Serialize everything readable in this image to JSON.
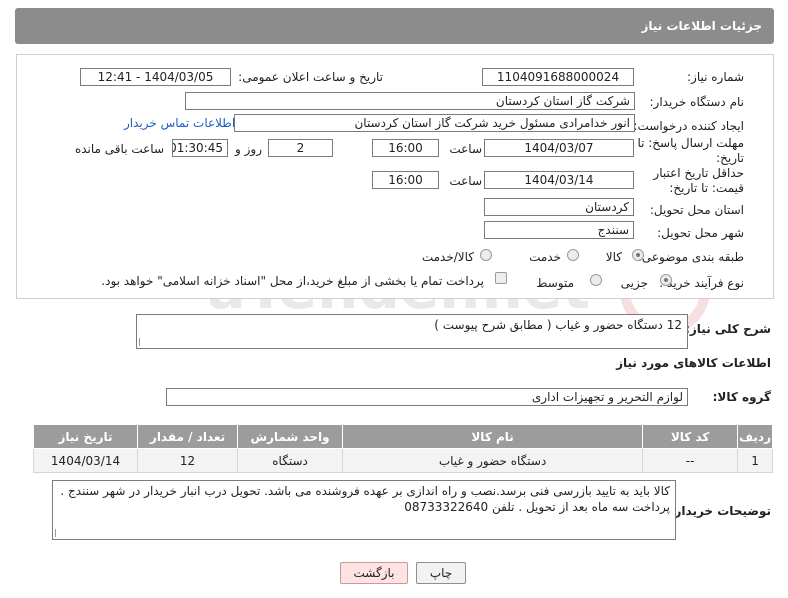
{
  "header": {
    "title": "جزئیات اطلاعات نیاز"
  },
  "form": {
    "need_number_label": "شماره نیاز:",
    "need_number": "1104091688000024",
    "announce_label": "تاریخ و ساعت اعلان عمومی:",
    "announce_value": "1404/03/05 - 12:41",
    "buyer_org_label": "نام دستگاه خریدار:",
    "buyer_org": "شرکت گاز استان کردستان",
    "creator_label": "ایجاد کننده درخواست:",
    "creator": "انور خدامرادی مسئول خرید  شرکت گاز استان کردستان",
    "contact_link": "اطلاعات تماس خریدار",
    "deadline_label": "مهلت ارسال پاسخ: تا تاریخ:",
    "deadline_date": "1404/03/07",
    "time_label": "ساعت",
    "deadline_time": "16:00",
    "days_value": "2",
    "days_label": "روز و",
    "remaining_time": "01:30:45",
    "remaining_label": "ساعت باقی مانده",
    "price_valid_label": "حداقل تاریخ اعتبار قیمت: تا تاریخ:",
    "price_valid_date": "1404/03/14",
    "price_valid_time": "16:00",
    "province_label": "استان محل تحویل:",
    "province": "کردستان",
    "city_label": "شهر محل تحویل:",
    "city": "سنندج",
    "category_label": "طبقه بندی موضوعی:",
    "category_options": [
      "کالا",
      "خدمت",
      "کالا/خدمت"
    ],
    "process_label": "نوع فرآیند خرید :",
    "process_options": [
      "جزیی",
      "متوسط"
    ],
    "payment_note": "پرداخت تمام یا بخشی از مبلغ خرید،از محل \"اسناد خزانه اسلامی\" خواهد بود."
  },
  "description": {
    "label": "شرح کلی نیاز:",
    "text": "12 دستگاه حضور و غیاب ( مطابق شرح پیوست )"
  },
  "goods": {
    "section_title": "اطلاعات کالاهای مورد نیاز",
    "group_label": "گروه کالا:",
    "group_value": "لوازم التحریر و تجهیزات اداری",
    "columns": [
      "ردیف",
      "کد کالا",
      "نام کالا",
      "واحد شمارش",
      "تعداد / مقدار",
      "تاریخ نیاز"
    ],
    "rows": [
      [
        "1",
        "--",
        "دستگاه حضور و غیاب",
        "دستگاه",
        "12",
        "1404/03/14"
      ]
    ]
  },
  "buyer_notes": {
    "label": "توضیحات خریدار:",
    "line1": "کالا باید به تایید بازرسی فنی  برسد.نصب و راه اندازی بر عهده فروشنده می باشد. تحویل درب انبار خریدار در شهر سنندج .",
    "line2": "پرداخت سه ماه بعد از تحویل . تلفن 08733322640"
  },
  "buttons": {
    "print": "چاپ",
    "back": "بازگشت"
  },
  "watermark_text": "AriaTender.net"
}
